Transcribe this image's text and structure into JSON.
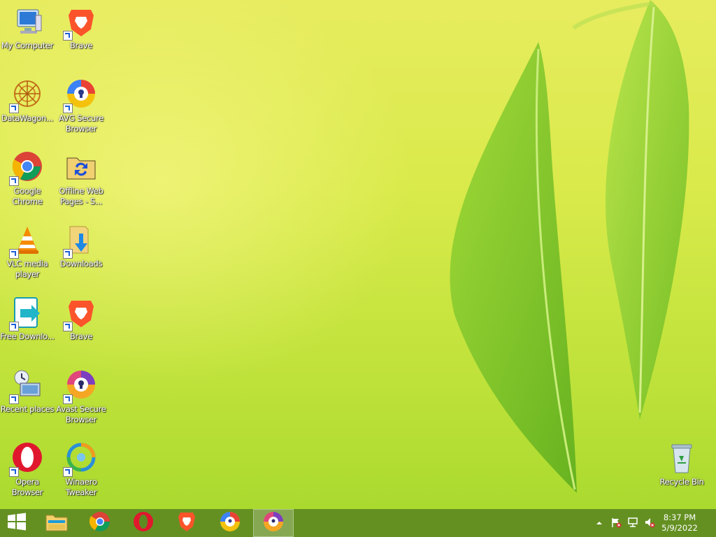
{
  "desktop": {
    "icons": [
      {
        "label": "My Computer",
        "icon": "computer-icon",
        "shortcut": false
      },
      {
        "label": "Brave",
        "icon": "brave-icon",
        "shortcut": true
      },
      {
        "label": "DataWagon...",
        "icon": "datawagon-icon",
        "shortcut": true
      },
      {
        "label": "AVG Secure Browser",
        "icon": "avg-browser-icon",
        "shortcut": true
      },
      {
        "label": "Google Chrome",
        "icon": "chrome-icon",
        "shortcut": true
      },
      {
        "label": "Offline Web Pages - S...",
        "icon": "offline-folder-icon",
        "shortcut": false
      },
      {
        "label": "VLC media player",
        "icon": "vlc-icon",
        "shortcut": true
      },
      {
        "label": "Downloads",
        "icon": "downloads-folder-icon",
        "shortcut": true
      },
      {
        "label": "Free Downlo...",
        "icon": "free-download-icon",
        "shortcut": true
      },
      {
        "label": "Brave",
        "icon": "brave-icon",
        "shortcut": true
      },
      {
        "label": "Recent places",
        "icon": "recent-places-icon",
        "shortcut": true
      },
      {
        "label": "Avast Secure Browser",
        "icon": "avast-browser-icon",
        "shortcut": true
      },
      {
        "label": "Opera Browser",
        "icon": "opera-icon",
        "shortcut": true
      },
      {
        "label": "Winaero Tweaker",
        "icon": "winaero-icon",
        "shortcut": true
      }
    ],
    "recycle_bin": {
      "label": "Recycle Bin",
      "icon": "recycle-bin-icon"
    }
  },
  "taskbar": {
    "items": [
      {
        "name": "start-button",
        "icon": "windows-logo-icon"
      },
      {
        "name": "file-explorer",
        "icon": "file-explorer-icon"
      },
      {
        "name": "chrome",
        "icon": "chrome-icon"
      },
      {
        "name": "opera",
        "icon": "opera-icon"
      },
      {
        "name": "brave",
        "icon": "brave-icon"
      },
      {
        "name": "avg-browser",
        "icon": "avg-browser-icon"
      },
      {
        "name": "avast-browser",
        "icon": "avast-browser-icon",
        "active": true
      }
    ],
    "tray": {
      "icons": [
        "show-hidden-icons-icon",
        "action-center-flag-icon",
        "network-icon",
        "volume-muted-icon"
      ],
      "time": "8:37 PM",
      "date": "5/9/2022"
    }
  },
  "colors": {
    "taskbar": "#5e8a22",
    "wallpaper_top": "#e7ec5f",
    "wallpaper_bottom": "#a6d82c"
  }
}
